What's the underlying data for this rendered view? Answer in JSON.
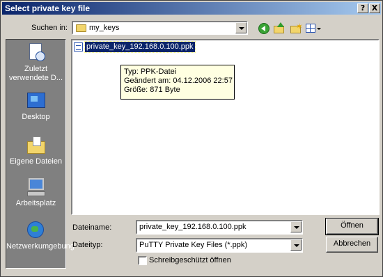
{
  "window": {
    "title": "Select private key file",
    "help_button": "?",
    "close_button": "X"
  },
  "toolbar": {
    "look_in_label": "Suchen in:",
    "look_in_value": "my_keys",
    "icons": [
      "back-icon",
      "up-folder-icon",
      "new-folder-icon",
      "view-menu-icon"
    ]
  },
  "places": [
    {
      "label": "Zuletzt verwendete D...",
      "icon": "recent-documents-icon"
    },
    {
      "label": "Desktop",
      "icon": "desktop-icon"
    },
    {
      "label": "Eigene Dateien",
      "icon": "my-documents-icon"
    },
    {
      "label": "Arbeitsplatz",
      "icon": "my-computer-icon"
    },
    {
      "label": "Netzwerkumgebung",
      "icon": "network-icon"
    }
  ],
  "files": [
    {
      "name": "private_key_192.168.0.100.ppk",
      "selected": true
    }
  ],
  "tooltip": {
    "type": "Typ: PPK-Datei",
    "modified": "Geändert am: 04.12.2006 22:57",
    "size": "Größe: 871 Byte"
  },
  "form": {
    "filename_label": "Dateiname:",
    "filename_value": "private_key_192.168.0.100.ppk",
    "filetype_label": "Dateityp:",
    "filetype_value": "PuTTY Private Key Files (*.ppk)",
    "readonly_label": "Schreibgeschützt öffnen",
    "readonly_checked": false
  },
  "buttons": {
    "open": "Öffnen",
    "cancel": "Abbrechen"
  },
  "colors": {
    "titlebar_start": "#0a246a",
    "titlebar_end": "#a6caf0",
    "face": "#d4d0c8",
    "selection": "#0a246a",
    "tooltip_bg": "#ffffe1"
  }
}
